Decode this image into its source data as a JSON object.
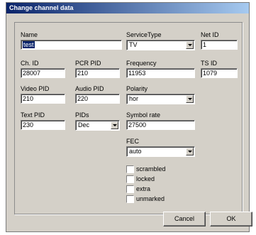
{
  "window": {
    "title": "Change channel data"
  },
  "fields": {
    "name": {
      "label": "Name",
      "value": "test"
    },
    "service_type": {
      "label": "ServiceType",
      "value": "TV"
    },
    "net_id": {
      "label": "Net ID",
      "value": "1"
    },
    "ch_id": {
      "label": "Ch. ID",
      "value": "28007"
    },
    "pcr_pid": {
      "label": "PCR PID",
      "value": "210"
    },
    "frequency": {
      "label": "Frequency",
      "value": "11953"
    },
    "ts_id": {
      "label": "TS ID",
      "value": "1079"
    },
    "video_pid": {
      "label": "Video PID",
      "value": "210"
    },
    "audio_pid": {
      "label": "Audio PID",
      "value": "220"
    },
    "polarity": {
      "label": "Polarity",
      "value": "hor"
    },
    "text_pid": {
      "label": "Text PID",
      "value": "230"
    },
    "pids": {
      "label": "PIDs",
      "value": "Dec"
    },
    "symbol_rate": {
      "label": "Symbol rate",
      "value": "27500"
    },
    "fec": {
      "label": "FEC",
      "value": "auto"
    }
  },
  "checkboxes": [
    {
      "label": "scrambled"
    },
    {
      "label": "locked"
    },
    {
      "label": "extra"
    },
    {
      "label": "unmarked"
    }
  ],
  "buttons": {
    "cancel": "Cancel",
    "ok": "OK"
  }
}
